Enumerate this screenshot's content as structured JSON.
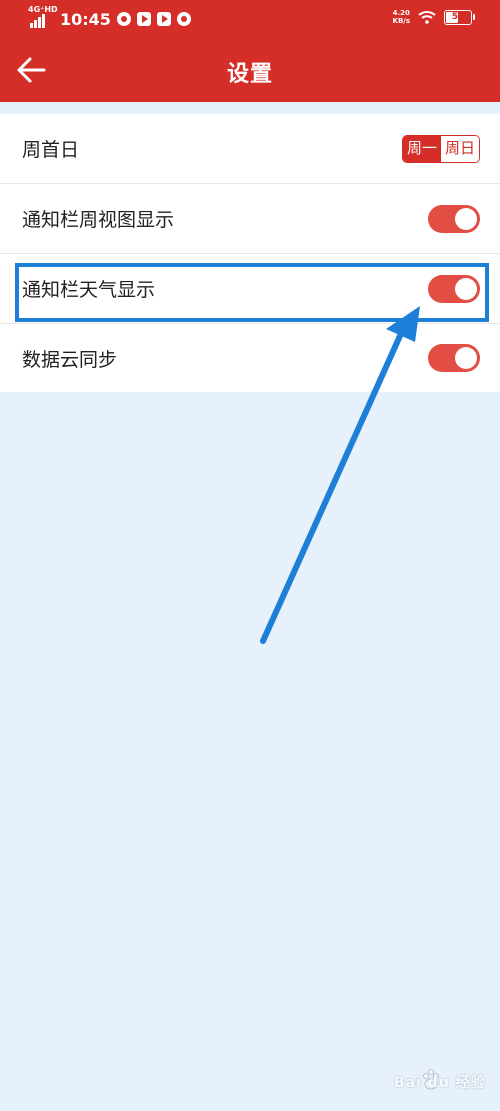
{
  "status_bar": {
    "network": "4G⁺HD",
    "time": "10:45",
    "speed_value": "4.20",
    "speed_unit": "KB/s",
    "battery": "54",
    "battery_level": 0.54
  },
  "header": {
    "title": "设置"
  },
  "settings": {
    "rows": [
      {
        "label": "周首日",
        "options": [
          "周一",
          "周日"
        ],
        "selected": "周一"
      },
      {
        "label": "通知栏周视图显示",
        "on": true
      },
      {
        "label": "通知栏天气显示",
        "on": true
      },
      {
        "label": "数据云同步",
        "on": true
      }
    ]
  },
  "watermark": {
    "text": "Bai du 经验"
  },
  "colors": {
    "brand_red": "#d52d28",
    "toggle_on": "#e24e43",
    "annotation_blue": "#1e7fd8",
    "page_bg": "#e6f1fb"
  }
}
